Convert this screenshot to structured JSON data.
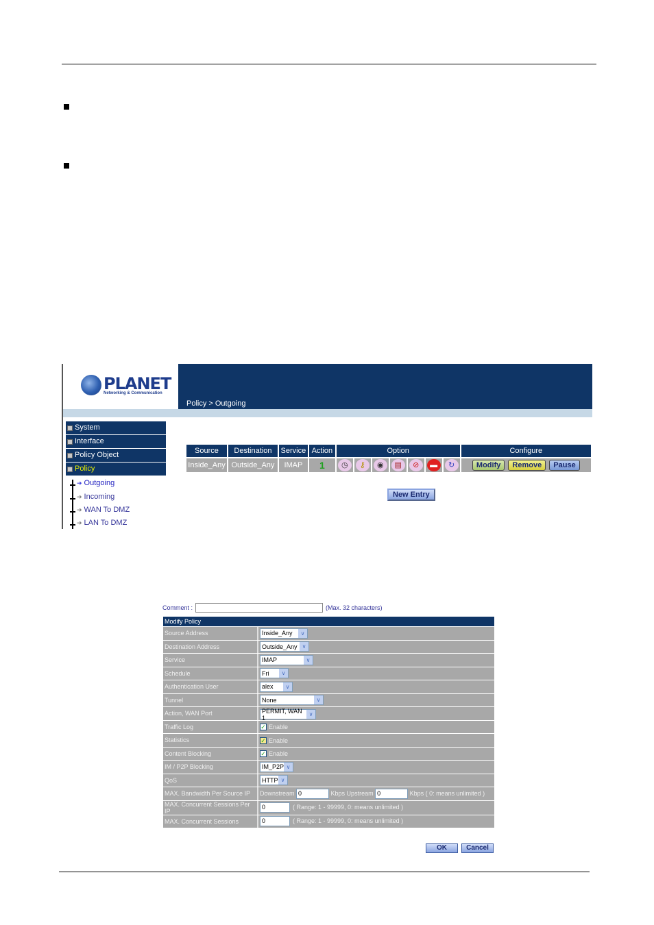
{
  "document": {
    "bullets": 2
  },
  "screenshot1": {
    "logo": {
      "brand": "PLANET",
      "tagline": "Networking & Communication"
    },
    "breadcrumb": "Policy > Outgoing",
    "menu": [
      {
        "label": "System",
        "icon": "plus-box-icon",
        "active": false
      },
      {
        "label": "Interface",
        "icon": "plus-box-icon",
        "active": false
      },
      {
        "label": "Policy Object",
        "icon": "plus-box-icon",
        "active": false
      },
      {
        "label": "Policy",
        "icon": "minus-box-icon",
        "active": true
      }
    ],
    "submenu": [
      {
        "label": "Outgoing",
        "active": true
      },
      {
        "label": "Incoming",
        "active": false
      },
      {
        "label": "WAN To DMZ",
        "active": false
      },
      {
        "label": "LAN To DMZ",
        "active": false
      }
    ],
    "table": {
      "headers": [
        "Source",
        "Destination",
        "Service",
        "Action",
        "Option",
        "Configure"
      ],
      "row": {
        "source": "Inside_Any",
        "destination": "Outside_Any",
        "service": "IMAP",
        "action_icon": "permit-arrow-icon",
        "option_icons": [
          "schedule-clock-icon",
          "authentication-key-icon",
          "traffic-log-eye-icon",
          "statistics-chart-icon",
          "content-blocking-icon",
          "im-p2p-blocking-icon",
          "qos-icon"
        ],
        "buttons": [
          "Modify",
          "Remove",
          "Pause"
        ]
      }
    },
    "new_entry_label": "New Entry"
  },
  "screenshot2": {
    "comment": {
      "label": "Comment :",
      "value": "",
      "hint": "(Max. 32 characters)"
    },
    "section_title": "Modify Policy",
    "rows": {
      "source_address": {
        "label": "Source Address",
        "value": "Inside_Any"
      },
      "destination_address": {
        "label": "Destination Address",
        "value": "Outside_Any"
      },
      "service": {
        "label": "Service",
        "value": "IMAP"
      },
      "schedule": {
        "label": "Schedule",
        "value": "Fri"
      },
      "auth_user": {
        "label": "Authentication User",
        "value": "alex"
      },
      "tunnel": {
        "label": "Tunnel",
        "value": "None"
      },
      "action_wan": {
        "label": "Action, WAN Port",
        "value": "PERMIT, WAN 1"
      },
      "traffic_log": {
        "label": "Traffic Log",
        "checkbox_label": "Enable",
        "checked": true
      },
      "statistics": {
        "label": "Statistics",
        "checkbox_label": "Enable",
        "checked": true
      },
      "content_blocking": {
        "label": "Content Blocking",
        "checkbox_label": "Enable",
        "checked": true
      },
      "im_p2p": {
        "label": "IM / P2P Blocking",
        "value": "IM_P2P"
      },
      "qos": {
        "label": "QoS",
        "value": "HTTP"
      },
      "bandwidth": {
        "label": "MAX. Bandwidth Per Source IP",
        "downstream_label": "Downstream",
        "downstream_value": "0",
        "upstream_label": "Kbps Upstream",
        "upstream_value": "0",
        "note": "Kbps ( 0: means unlimited )"
      },
      "sessions_per_ip": {
        "label": "MAX. Concurrent Sessions Per IP",
        "value": "0",
        "note": "( Range: 1 - 99999, 0: means unlimited )"
      },
      "sessions": {
        "label": "MAX. Concurrent Sessions",
        "value": "0",
        "note": "( Range: 1 - 99999, 0: means unlimited )"
      }
    },
    "buttons": {
      "ok": "OK",
      "cancel": "Cancel"
    }
  },
  "colors": {
    "navy": "#0f3566",
    "row_gray": "#a8a8a8",
    "light_blue_bar": "#c6d8e6",
    "active_menu_text": "#e8f000"
  }
}
